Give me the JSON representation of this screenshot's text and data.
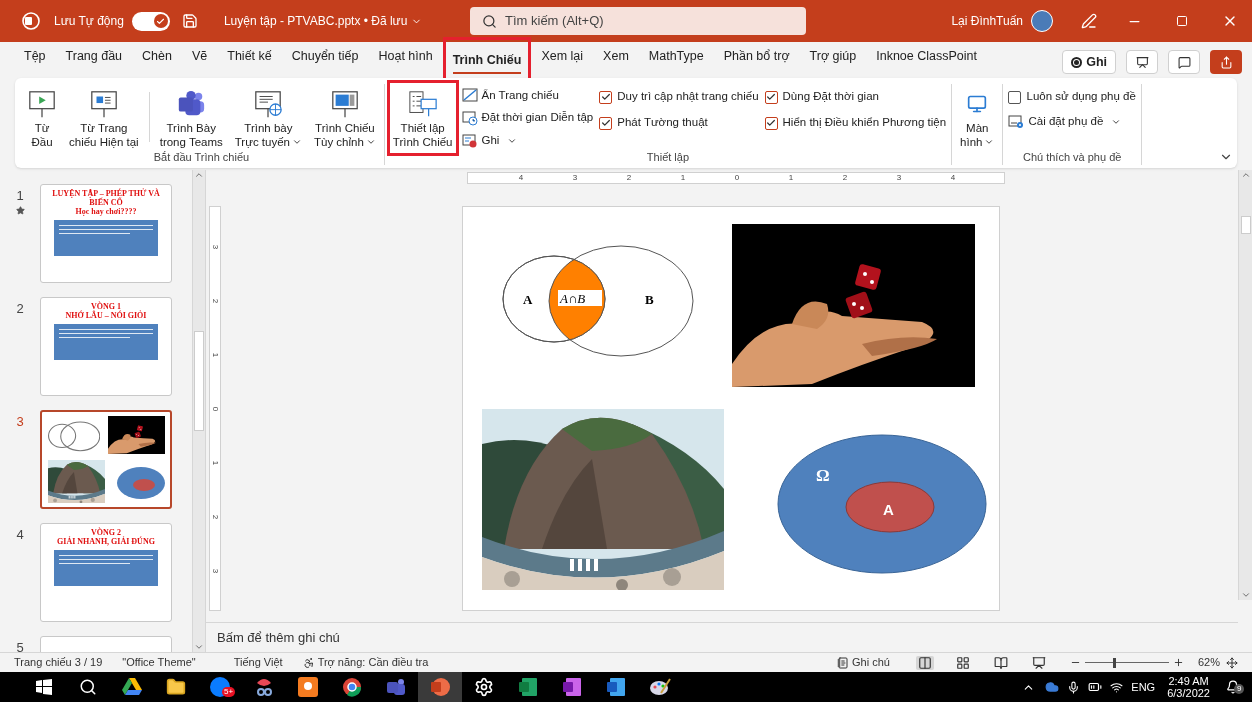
{
  "title_bar": {
    "autosave_label": "Lưu Tự động",
    "autosave_on": true,
    "file_name": "Luyện tập - PTVABC.pptx • Đã lưu",
    "search_placeholder": "Tìm kiếm (Alt+Q)",
    "user_name": "Lại ĐìnhTuấn"
  },
  "tabs": [
    {
      "label": "Tệp",
      "selected": false,
      "highlighted": false
    },
    {
      "label": "Trang đầu",
      "selected": false,
      "highlighted": false
    },
    {
      "label": "Chèn",
      "selected": false,
      "highlighted": false
    },
    {
      "label": "Vẽ",
      "selected": false,
      "highlighted": false
    },
    {
      "label": "Thiết kế",
      "selected": false,
      "highlighted": false
    },
    {
      "label": "Chuyển tiếp",
      "selected": false,
      "highlighted": false
    },
    {
      "label": "Hoạt hình",
      "selected": false,
      "highlighted": false
    },
    {
      "label": "Trình Chiếu",
      "selected": true,
      "highlighted": true
    },
    {
      "label": "Xem lại",
      "selected": false,
      "highlighted": false
    },
    {
      "label": "Xem",
      "selected": false,
      "highlighted": false
    },
    {
      "label": "MathType",
      "selected": false,
      "highlighted": false
    },
    {
      "label": "Phần bổ trợ",
      "selected": false,
      "highlighted": false
    },
    {
      "label": "Trợ giúp",
      "selected": false,
      "highlighted": false
    },
    {
      "label": "Inknoe ClassPoint",
      "selected": false,
      "highlighted": false
    }
  ],
  "tab_bar_buttons": [
    {
      "kind": "record",
      "label": "Ghi"
    },
    {
      "kind": "present"
    },
    {
      "kind": "comments"
    },
    {
      "kind": "share"
    }
  ],
  "ribbon": {
    "groups": [
      {
        "title": "Bắt đầu Trình chiếu",
        "items": [
          {
            "kind": "large",
            "lines": [
              "Từ",
              "Đầu"
            ],
            "dropdown": false,
            "highlighted": false
          },
          {
            "kind": "large",
            "lines": [
              "Từ Trang",
              "chiếu Hiện tại"
            ],
            "dropdown": false,
            "highlighted": false
          },
          {
            "kind": "separator"
          },
          {
            "kind": "large",
            "lines": [
              "Trình Bày",
              "trong Teams"
            ],
            "dropdown": false,
            "highlighted": false
          },
          {
            "kind": "large",
            "lines": [
              "Trình bày",
              "Trực tuyến"
            ],
            "dropdown": true,
            "highlighted": false
          },
          {
            "kind": "large",
            "lines": [
              "Trình Chiếu",
              "Tùy chỉnh"
            ],
            "dropdown": true,
            "highlighted": false
          }
        ]
      },
      {
        "title": "Thiết lập",
        "items": [
          {
            "kind": "large",
            "lines": [
              "Thiết lập",
              "Trình Chiếu"
            ],
            "dropdown": false,
            "highlighted": true
          },
          {
            "kind": "stack",
            "items": [
              {
                "kind": "small",
                "label": "Ẩn Trang chiếu",
                "dropdown": false
              },
              {
                "kind": "small",
                "label": "Đặt thời gian Diễn tập",
                "dropdown": false
              },
              {
                "kind": "small",
                "label": "Ghi",
                "dropdown": true
              }
            ]
          },
          {
            "kind": "stack",
            "items": [
              {
                "kind": "check",
                "label": "Duy trì cập nhật trang chiếu",
                "checked": true
              },
              {
                "kind": "check",
                "label": "Phát Tường thuật",
                "checked": true
              }
            ]
          },
          {
            "kind": "stack",
            "items": [
              {
                "kind": "check",
                "label": "Dùng Đặt thời gian",
                "checked": true
              },
              {
                "kind": "check",
                "label": "Hiển thị Điều khiển Phương tiện",
                "checked": true
              }
            ]
          }
        ]
      },
      {
        "items": [
          {
            "kind": "large",
            "lines": [
              "Màn",
              "hình"
            ],
            "dropdown": true,
            "highlighted": false
          }
        ]
      },
      {
        "title": "Chú thích và phụ đề",
        "items": [
          {
            "kind": "stack",
            "items": [
              {
                "kind": "check",
                "label": "Luôn sử dụng phụ đề",
                "checked": false
              },
              {
                "kind": "small",
                "label": "Cài đặt phụ đề",
                "dropdown": true
              }
            ]
          }
        ]
      }
    ]
  },
  "slides": [
    {
      "number": "1",
      "starred": true,
      "selected": false,
      "kind": "title",
      "lines": [
        "LUYỆN TẬP – PHÉP THỬ VÀ BIẾN CỐ",
        "Học hay chơi????"
      ]
    },
    {
      "number": "2",
      "starred": false,
      "selected": false,
      "kind": "title",
      "lines": [
        "VÒNG 1",
        "NHỚ LÂU – NÓI GIỎI"
      ]
    },
    {
      "number": "3",
      "starred": false,
      "selected": true,
      "kind": "pictures"
    },
    {
      "number": "4",
      "starred": false,
      "selected": false,
      "kind": "title",
      "lines": [
        "VÒNG 2",
        "GIẢI NHANH, GIẢI ĐÚNG"
      ]
    },
    {
      "number": "5",
      "selected": false,
      "kind": "partial"
    }
  ],
  "horizontal_ruler": [
    "4",
    "3",
    "2",
    "1",
    "0",
    "1",
    "2",
    "3",
    "4"
  ],
  "vertical_ruler": [
    "3",
    "2",
    "1",
    "0",
    "1",
    "2",
    "3"
  ],
  "current_slide": {
    "venn": {
      "left_label": "A",
      "intersection_label": "A∩B",
      "right_label": "B"
    },
    "sample_space": {
      "outer_label": "Ω",
      "inner_label": "A"
    }
  },
  "notes_placeholder": "Bấm để thêm ghi chú",
  "status_bar": {
    "slide_position": "Trang chiếu 3 / 19",
    "theme": "\"Office Theme\"",
    "language": "Tiếng Việt",
    "accessibility": "Trợ năng: Cần điều tra",
    "notes_label": "Ghi chú",
    "views": [
      {
        "kind": "normal",
        "selected": true
      },
      {
        "kind": "sorter",
        "selected": false
      },
      {
        "kind": "reading",
        "selected": false
      },
      {
        "kind": "slideshow",
        "selected": false
      }
    ],
    "zoom": {
      "level": 0.33,
      "reading": "62%"
    }
  },
  "taskbar": {
    "apps": [
      {
        "kind": "start",
        "selected": false
      },
      {
        "kind": "search",
        "selected": false
      },
      {
        "kind": "drive",
        "selected": false
      },
      {
        "kind": "folder",
        "selected": false
      },
      {
        "kind": "chat",
        "selected": false,
        "badge": "5+"
      },
      {
        "kind": "snip",
        "selected": false
      },
      {
        "kind": "pdf",
        "selected": false
      },
      {
        "kind": "browser",
        "selected": false
      },
      {
        "kind": "teams",
        "selected": false
      },
      {
        "kind": "presentation",
        "selected": true
      },
      {
        "kind": "settings",
        "selected": false
      },
      {
        "kind": "spreadsheet",
        "selected": false
      },
      {
        "kind": "notes",
        "selected": false
      },
      {
        "kind": "document",
        "selected": false
      },
      {
        "kind": "paint",
        "selected": false
      }
    ],
    "tray": {
      "language": "ENG",
      "time": "2:49 AM",
      "date": "6/3/2022",
      "notification_count": "9"
    }
  }
}
